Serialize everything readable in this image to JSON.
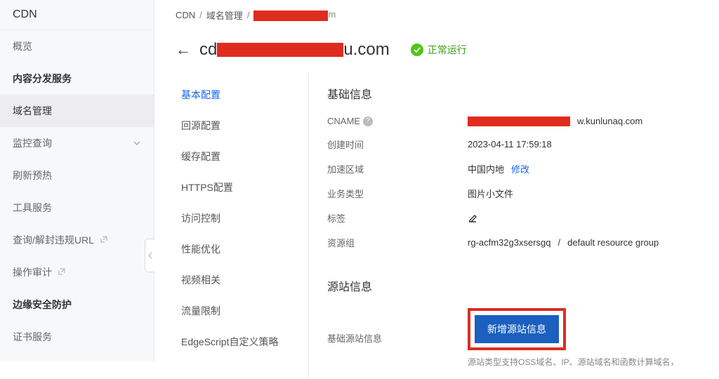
{
  "sidebar": {
    "product": "CDN",
    "items": [
      {
        "label": "概览",
        "type": "plain"
      },
      {
        "label": "内容分发服务",
        "type": "section"
      },
      {
        "label": "域名管理",
        "type": "active"
      },
      {
        "label": "监控查询",
        "type": "expand"
      },
      {
        "label": "刷新预热",
        "type": "plain"
      },
      {
        "label": "工具服务",
        "type": "plain"
      },
      {
        "label": "查询/解封违规URL",
        "type": "ext"
      },
      {
        "label": "操作审计",
        "type": "ext"
      },
      {
        "label": "边缘安全防护",
        "type": "section"
      },
      {
        "label": "证书服务",
        "type": "plain"
      }
    ]
  },
  "breadcrumb": {
    "a": "CDN",
    "b": "域名管理",
    "suffix": "m"
  },
  "header": {
    "title_prefix": "cd",
    "title_suffix": "u.com",
    "status": "正常运行"
  },
  "tabs": [
    {
      "label": "基本配置",
      "active": true
    },
    {
      "label": "回源配置"
    },
    {
      "label": "缓存配置"
    },
    {
      "label": "HTTPS配置"
    },
    {
      "label": "访问控制"
    },
    {
      "label": "性能优化"
    },
    {
      "label": "视频相关"
    },
    {
      "label": "流量限制"
    },
    {
      "label": "EdgeScript自定义策略"
    }
  ],
  "basic_info": {
    "title": "基础信息",
    "rows": {
      "cname_k": "CNAME",
      "cname_suffix": "w.kunlunaq.com",
      "created_k": "创建时间",
      "created_v": "2023-04-11 17:59:18",
      "region_k": "加速区域",
      "region_v": "中国内地",
      "region_action": "修改",
      "biz_k": "业务类型",
      "biz_v": "图片小文件",
      "tag_k": "标签",
      "rg_k": "资源组",
      "rg_v1": "rg-acfm32g3xsersgq",
      "rg_v2": "default resource group"
    }
  },
  "source_info": {
    "title": "源站信息",
    "sub_label": "基础源站信息",
    "add_btn": "新增源站信息",
    "hint": "源站类型支持OSS域名、IP、源站域名和函数计算域名，"
  }
}
